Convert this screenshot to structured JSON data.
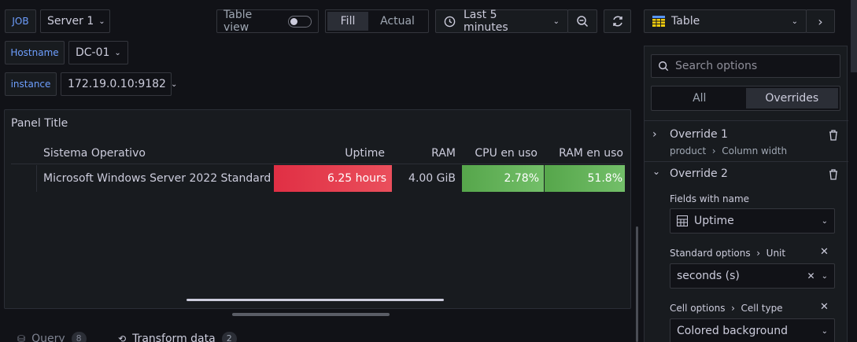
{
  "vars": {
    "job": {
      "label": "JOB",
      "value": "Server 1"
    },
    "hostname": {
      "label": "Hostname",
      "value": "DC-01"
    },
    "instance": {
      "label": "instance",
      "value": "172.19.0.10:9182"
    }
  },
  "toolbar": {
    "table_view": "Table view",
    "fill": "Fill",
    "actual": "Actual",
    "time_range": "Last 5 minutes"
  },
  "viz": {
    "type": "Table"
  },
  "panel": {
    "title": "Panel Title",
    "columns": [
      "Sistema Operativo",
      "Uptime",
      "RAM",
      "CPU en uso",
      "RAM en uso"
    ],
    "row": {
      "os": "Microsoft Windows Server 2022 Standard",
      "uptime": "6.25 hours",
      "ram": "4.00 GiB",
      "cpu": "2.78%",
      "ram_used": "51.8%"
    },
    "cpu_fill": 0.0278,
    "ram_fill": 0.518
  },
  "tabs": {
    "query": "Query",
    "query_count": "8",
    "transform": "Transform data",
    "transform_count": "2"
  },
  "options": {
    "search_placeholder": "Search options",
    "all": "All",
    "overrides": "Overrides",
    "override1": {
      "title": "Override 1",
      "crumb1": "product",
      "crumb2": "Column width"
    },
    "override2": {
      "title": "Override 2",
      "fields_with_name": "Fields with name",
      "field_value": "Uptime",
      "prop1_a": "Standard options",
      "prop1_b": "Unit",
      "unit_value": "seconds (s)",
      "prop2_a": "Cell options",
      "prop2_b": "Cell type",
      "cell_type_value": "Colored background"
    }
  },
  "colors": {
    "red": "#e02f44",
    "green": "#56a64b",
    "accent": "#6e9fff"
  }
}
